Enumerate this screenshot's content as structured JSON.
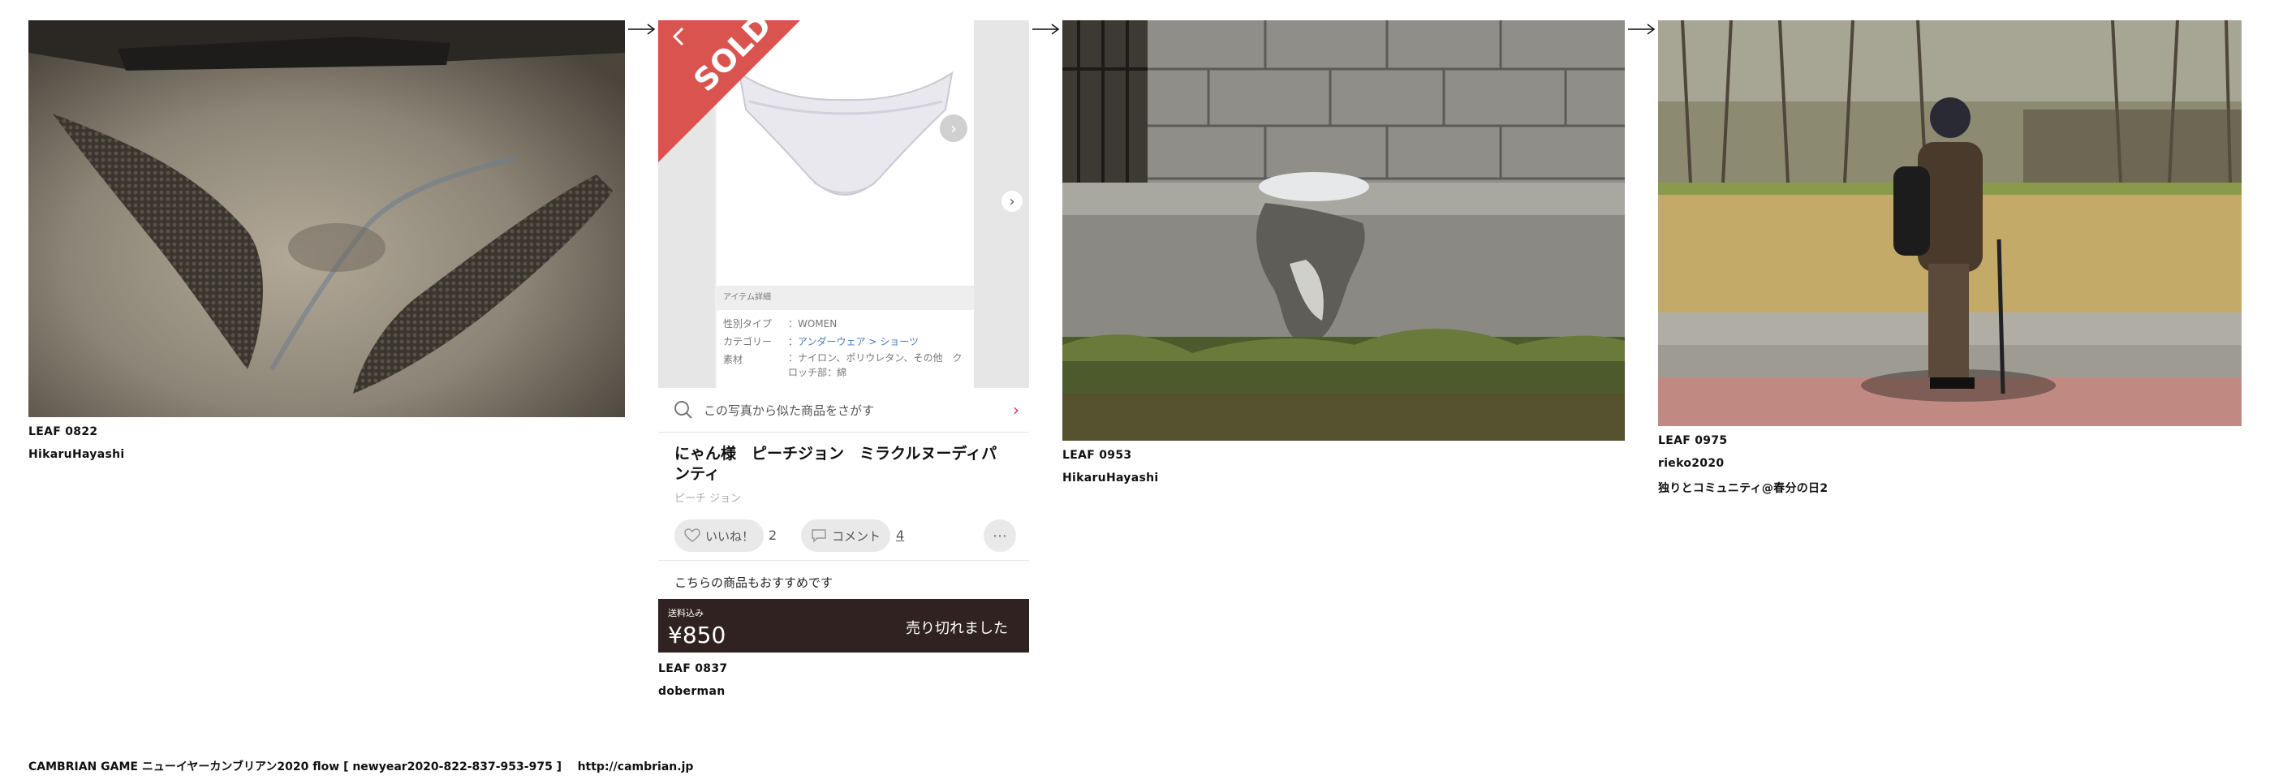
{
  "leaves": [
    {
      "caption": "LEAF 0822",
      "author": "HikaruHayashi",
      "note": ""
    },
    {
      "caption": "LEAF 0837",
      "author": "doberman",
      "note": ""
    },
    {
      "caption": "LEAF 0953",
      "author": "HikaruHayashi",
      "note": ""
    },
    {
      "caption": "LEAF 0975",
      "author": "rieko2020",
      "note": "独りとコミュニティ@春分の日2"
    }
  ],
  "shop": {
    "sold_badge": "SOLD",
    "item_details_header": "アイテム詳細",
    "details": [
      {
        "label": "性別タイプ",
        "value": "：WOMEN"
      },
      {
        "label": "カテゴリー",
        "value": "：アンダーウェア > ショーツ"
      },
      {
        "label": "素材",
        "value": "：ナイロン、ポリウレタン、その他　クロッチ部：綿"
      }
    ],
    "similar_search": "この写真から似た商品をさがす",
    "title": "にゃん様　ピーチジョン　ミラクルヌーディパンティ",
    "brand": "ピーチ ジョン",
    "like_label": "いいね！",
    "like_count": "2",
    "comment_label": "コメント",
    "comment_count": "4",
    "recommend": "こちらの商品もおすすめです",
    "shipping": "送料込み",
    "price": "¥850",
    "soldout": "売り切れました"
  },
  "footer": {
    "text": "CAMBRIAN GAME  ニューイヤーカンブリアン2020  flow [ newyear2020-822-837-953-975 ]",
    "url": "http://cambrian.jp"
  },
  "colors": {
    "sold_red": "#d9534f",
    "price_bar": "#2f2220",
    "pink_chevron": "#d9336b"
  }
}
